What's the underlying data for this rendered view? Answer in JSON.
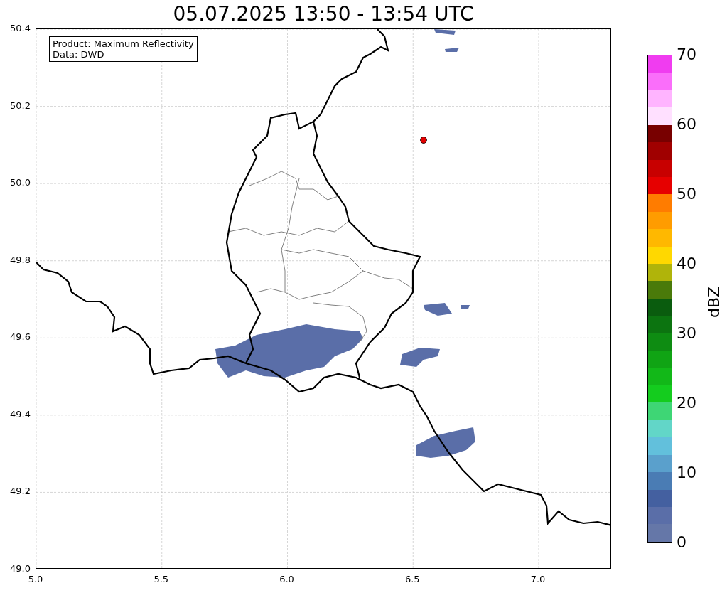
{
  "title": "05.07.2025 13:50 - 13:54 UTC",
  "info_box": {
    "lines": [
      "Product: Maximum Reflectivity",
      "Data: DWD"
    ]
  },
  "x_ticks": [
    "5.0",
    "5.5",
    "6.0",
    "6.5",
    "7.0"
  ],
  "y_ticks": [
    "50.4",
    "50.2",
    "50.0",
    "49.8",
    "49.6",
    "49.4",
    "49.2",
    "49.0"
  ],
  "colorbar": {
    "label": "dBZ",
    "ticks": [
      "70",
      "60",
      "50",
      "40",
      "30",
      "20",
      "10",
      "0"
    ],
    "segments": [
      {
        "color": "#f03cf0"
      },
      {
        "color": "#fa6efa"
      },
      {
        "color": "#ffb4ff"
      },
      {
        "color": "#ffe0ff"
      },
      {
        "color": "#780000"
      },
      {
        "color": "#a00000"
      },
      {
        "color": "#c80000"
      },
      {
        "color": "#e60000"
      },
      {
        "color": "#ff7c00"
      },
      {
        "color": "#ff9c00"
      },
      {
        "color": "#ffb800"
      },
      {
        "color": "#ffd800"
      },
      {
        "color": "#b0b40a"
      },
      {
        "color": "#4a7a0a"
      },
      {
        "color": "#0a5c0e"
      },
      {
        "color": "#0c7410"
      },
      {
        "color": "#0e8c12"
      },
      {
        "color": "#10a414"
      },
      {
        "color": "#12b818"
      },
      {
        "color": "#14cc1e"
      },
      {
        "color": "#3ed675"
      },
      {
        "color": "#62d6c8"
      },
      {
        "color": "#62c0dc"
      },
      {
        "color": "#5aa0cc"
      },
      {
        "color": "#4a7cb4"
      },
      {
        "color": "#4460a0"
      },
      {
        "color": "#5a6ea8"
      },
      {
        "color": "#6577a8"
      }
    ]
  }
}
